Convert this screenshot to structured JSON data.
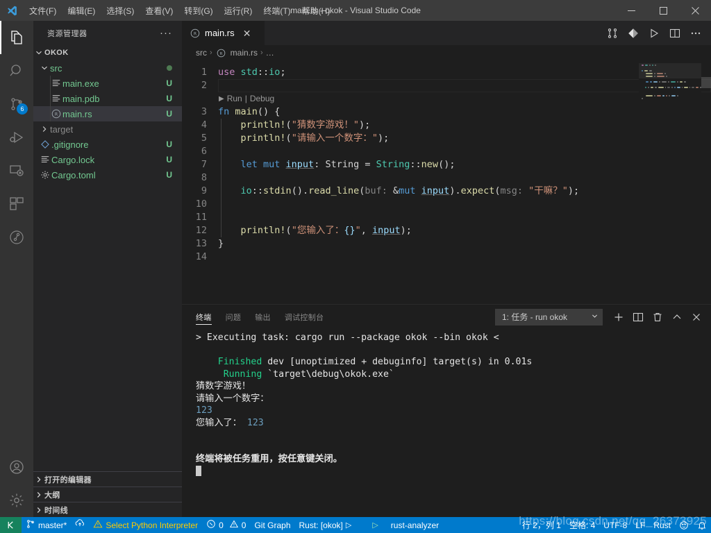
{
  "window": {
    "title": "main.rs - okok - Visual Studio Code",
    "minimize": "─",
    "maximize": "□",
    "close": "✕"
  },
  "menubar": {
    "items": [
      {
        "label": "文件(F)",
        "name": "menu-file"
      },
      {
        "label": "编辑(E)",
        "name": "menu-edit"
      },
      {
        "label": "选择(S)",
        "name": "menu-selection"
      },
      {
        "label": "查看(V)",
        "name": "menu-view"
      },
      {
        "label": "转到(G)",
        "name": "menu-go"
      },
      {
        "label": "运行(R)",
        "name": "menu-run"
      },
      {
        "label": "终端(T)",
        "name": "menu-terminal"
      },
      {
        "label": "帮助(H)",
        "name": "menu-help"
      }
    ]
  },
  "activitybar": {
    "items": [
      {
        "name": "explorer-icon",
        "active": true,
        "badge": ""
      },
      {
        "name": "search-icon",
        "active": false,
        "badge": ""
      },
      {
        "name": "source-control-icon",
        "active": false,
        "badge": "6"
      },
      {
        "name": "run-debug-icon",
        "active": false,
        "badge": ""
      },
      {
        "name": "remote-explorer-icon",
        "active": false,
        "badge": ""
      },
      {
        "name": "extensions-icon",
        "active": false,
        "badge": ""
      },
      {
        "name": "testing-icon",
        "active": false,
        "badge": ""
      }
    ],
    "bottom": [
      {
        "name": "account-icon"
      },
      {
        "name": "settings-gear-icon"
      }
    ],
    "badge_color": "#007acc"
  },
  "sidebar": {
    "title": "资源管理器",
    "more_actions": "···",
    "root": {
      "label": "OKOK",
      "expanded": true
    },
    "tree": [
      {
        "label": "src",
        "indent": 1,
        "kind": "folder",
        "expanded": true,
        "badge": "",
        "dot": true,
        "selected": false,
        "icon": "folder-icon"
      },
      {
        "label": "main.exe",
        "indent": 2,
        "kind": "file",
        "expanded": null,
        "badge": "U",
        "dot": false,
        "selected": false,
        "icon": "binary-file-icon"
      },
      {
        "label": "main.pdb",
        "indent": 2,
        "kind": "file",
        "expanded": null,
        "badge": "U",
        "dot": false,
        "selected": false,
        "icon": "binary-file-icon"
      },
      {
        "label": "main.rs",
        "indent": 2,
        "kind": "file",
        "expanded": null,
        "badge": "U",
        "dot": false,
        "selected": true,
        "icon": "rust-file-icon"
      },
      {
        "label": "target",
        "indent": 1,
        "kind": "folder",
        "expanded": false,
        "badge": "",
        "dot": false,
        "selected": false,
        "icon": "folder-icon"
      },
      {
        "label": ".gitignore",
        "indent": 1,
        "kind": "file",
        "expanded": null,
        "badge": "U",
        "dot": false,
        "selected": false,
        "icon": "git-file-icon"
      },
      {
        "label": "Cargo.lock",
        "indent": 1,
        "kind": "file",
        "expanded": null,
        "badge": "U",
        "dot": false,
        "selected": false,
        "icon": "lock-file-icon"
      },
      {
        "label": "Cargo.toml",
        "indent": 1,
        "kind": "file",
        "expanded": null,
        "badge": "U",
        "dot": false,
        "selected": false,
        "icon": "toml-file-icon"
      }
    ],
    "sections": [
      {
        "label": "打开的编辑器",
        "name": "section-open-editors"
      },
      {
        "label": "大纲",
        "name": "section-outline"
      },
      {
        "label": "时间线",
        "name": "section-timeline"
      }
    ]
  },
  "editor": {
    "tab": {
      "label": "main.rs",
      "close": "✕",
      "icon": "rust-file-icon"
    },
    "actions": [
      {
        "name": "compare-changes-icon"
      },
      {
        "name": "git-diff-icon"
      },
      {
        "name": "run-code-icon"
      },
      {
        "name": "split-editor-icon"
      },
      {
        "name": "more-actions-icon"
      }
    ],
    "breadcrumb": [
      {
        "label": "src",
        "icon": ""
      },
      {
        "label": "main.rs",
        "icon": "rust-file-icon"
      },
      {
        "label": "…",
        "icon": ""
      }
    ],
    "breadcrumb_sep": "›",
    "codelens": {
      "run": "Run",
      "sep": "|",
      "debug": "Debug",
      "play": "▶"
    },
    "line_numbers": [
      "1",
      "2",
      "3",
      "4",
      "5",
      "6",
      "7",
      "8",
      "9",
      "10",
      "11",
      "12",
      "13",
      "14"
    ],
    "code_lines": [
      {
        "n": 1,
        "tokens": [
          {
            "t": "use ",
            "c": "kwc"
          },
          {
            "t": "std",
            "c": "mod"
          },
          {
            "t": "::",
            "c": "pun"
          },
          {
            "t": "io",
            "c": "type"
          },
          {
            "t": ";",
            "c": "pun"
          }
        ]
      },
      {
        "n": 2,
        "tokens": []
      },
      {
        "n": 3,
        "tokens": [
          {
            "t": "fn ",
            "c": "kw"
          },
          {
            "t": "main",
            "c": "fn"
          },
          {
            "t": "() {",
            "c": "pun"
          }
        ]
      },
      {
        "n": 4,
        "tokens": [
          {
            "t": "    ",
            "c": "pun"
          },
          {
            "t": "println!",
            "c": "mac"
          },
          {
            "t": "(",
            "c": "pun"
          },
          {
            "t": "\"猜数字游戏！\"",
            "c": "str"
          },
          {
            "t": ");",
            "c": "pun"
          }
        ]
      },
      {
        "n": 5,
        "tokens": [
          {
            "t": "    ",
            "c": "pun"
          },
          {
            "t": "println!",
            "c": "mac"
          },
          {
            "t": "(",
            "c": "pun"
          },
          {
            "t": "\"请输入一个数字：\"",
            "c": "str"
          },
          {
            "t": ");",
            "c": "pun"
          }
        ]
      },
      {
        "n": 6,
        "tokens": []
      },
      {
        "n": 7,
        "tokens": [
          {
            "t": "    ",
            "c": "pun"
          },
          {
            "t": "let ",
            "c": "kw"
          },
          {
            "t": "mut ",
            "c": "kw"
          },
          {
            "t": "input",
            "c": "var uline"
          },
          {
            "t": ": ",
            "c": "pun"
          },
          {
            "t": "String",
            "c": "pun"
          },
          {
            "t": " = ",
            "c": "pun"
          },
          {
            "t": "String",
            "c": "type"
          },
          {
            "t": "::",
            "c": "pun"
          },
          {
            "t": "new",
            "c": "fn"
          },
          {
            "t": "();",
            "c": "pun"
          }
        ]
      },
      {
        "n": 8,
        "tokens": []
      },
      {
        "n": 9,
        "tokens": [
          {
            "t": "    ",
            "c": "pun"
          },
          {
            "t": "io",
            "c": "type"
          },
          {
            "t": "::",
            "c": "pun"
          },
          {
            "t": "stdin",
            "c": "fn"
          },
          {
            "t": "().",
            "c": "pun"
          },
          {
            "t": "read_line",
            "c": "fn"
          },
          {
            "t": "(",
            "c": "pun"
          },
          {
            "t": "buf: ",
            "c": "hint"
          },
          {
            "t": "&",
            "c": "pun"
          },
          {
            "t": "mut ",
            "c": "kw"
          },
          {
            "t": "input",
            "c": "var uline"
          },
          {
            "t": ").",
            "c": "pun"
          },
          {
            "t": "expect",
            "c": "fn"
          },
          {
            "t": "(",
            "c": "pun"
          },
          {
            "t": "msg: ",
            "c": "hint"
          },
          {
            "t": "\"干嘛？\"",
            "c": "str"
          },
          {
            "t": ");",
            "c": "pun"
          }
        ]
      },
      {
        "n": 10,
        "tokens": []
      },
      {
        "n": 11,
        "tokens": []
      },
      {
        "n": 12,
        "tokens": [
          {
            "t": "    ",
            "c": "pun"
          },
          {
            "t": "println!",
            "c": "mac"
          },
          {
            "t": "(",
            "c": "pun"
          },
          {
            "t": "\"您输入了：",
            "c": "str"
          },
          {
            "t": "{}",
            "c": "var"
          },
          {
            "t": "\"",
            "c": "str"
          },
          {
            "t": ", ",
            "c": "pun"
          },
          {
            "t": "input",
            "c": "var uline"
          },
          {
            "t": ");",
            "c": "pun"
          }
        ]
      },
      {
        "n": 13,
        "tokens": [
          {
            "t": "}",
            "c": "pun"
          }
        ]
      },
      {
        "n": 14,
        "tokens": []
      }
    ]
  },
  "panel": {
    "tabs": [
      {
        "label": "终端",
        "active": true,
        "name": "panel-tab-terminal"
      },
      {
        "label": "问题",
        "active": false,
        "name": "panel-tab-problems"
      },
      {
        "label": "输出",
        "active": false,
        "name": "panel-tab-output"
      },
      {
        "label": "调试控制台",
        "active": false,
        "name": "panel-tab-debug-console"
      }
    ],
    "terminal_select": {
      "value": "1: 任务 - run okok",
      "chevron": "⌄"
    },
    "actions": [
      {
        "name": "new-terminal-icon",
        "glyph": "+"
      },
      {
        "name": "split-terminal-icon",
        "glyph": ""
      },
      {
        "name": "kill-terminal-icon",
        "glyph": ""
      },
      {
        "name": "maximize-panel-icon",
        "glyph": "^"
      },
      {
        "name": "close-panel-icon",
        "glyph": "✕"
      }
    ],
    "terminal_lines": [
      {
        "parts": [
          {
            "t": "> Executing task: cargo run --package okok --bin okok <",
            "c": "t-white"
          }
        ]
      },
      {
        "parts": []
      },
      {
        "parts": [
          {
            "t": "    ",
            "c": ""
          },
          {
            "t": "Finished",
            "c": "t-green"
          },
          {
            "t": " dev [unoptimized + debuginfo] target(s) in 0.01s",
            "c": "t-white"
          }
        ]
      },
      {
        "parts": [
          {
            "t": "     ",
            "c": ""
          },
          {
            "t": "Running",
            "c": "t-green"
          },
          {
            "t": " `target\\debug\\okok.exe`",
            "c": "t-white"
          }
        ]
      },
      {
        "parts": [
          {
            "t": "猜数字游戏！",
            "c": "t-white"
          }
        ]
      },
      {
        "parts": [
          {
            "t": "请输入一个数字：",
            "c": "t-white"
          }
        ]
      },
      {
        "parts": [
          {
            "t": "123",
            "c": "t-cyan"
          }
        ]
      },
      {
        "parts": [
          {
            "t": "您输入了： ",
            "c": "t-white"
          },
          {
            "t": "123",
            "c": "t-cyan"
          }
        ]
      },
      {
        "parts": []
      },
      {
        "parts": []
      },
      {
        "parts": [
          {
            "t": "终端将被任务重用，按任意键关闭。",
            "c": "t-bold"
          }
        ]
      }
    ]
  },
  "statusbar": {
    "remote_icon": "remote-window-icon",
    "left": [
      {
        "label": "master*",
        "icon": "source-control-branch-icon",
        "name": "status-branch"
      },
      {
        "label": "",
        "icon": "sync-changes-icon",
        "name": "status-sync"
      },
      {
        "label": "Select Python Interpreter",
        "icon": "warning-triangle-icon",
        "name": "status-python-interpreter",
        "warn": true
      },
      {
        "label": "0",
        "icon": "error-icon",
        "label2": "0",
        "icon2": "warning-icon",
        "name": "status-problems"
      },
      {
        "label": "Git Graph",
        "icon": "",
        "name": "status-git-graph"
      },
      {
        "label": "Rust: [okok]",
        "icon": "",
        "name": "status-rust-target",
        "trailing": "▷"
      },
      {
        "label": "rust-analyzer",
        "icon": "",
        "name": "status-rust-analyzer",
        "leading": "▷"
      }
    ],
    "right": [
      {
        "label": "行 2，列 1",
        "name": "status-line-col"
      },
      {
        "label": "空格: 4",
        "name": "status-indentation"
      },
      {
        "label": "UTF-8",
        "name": "status-encoding"
      },
      {
        "label": "LF",
        "name": "status-eol"
      },
      {
        "label": "Rust",
        "name": "status-language-mode"
      },
      {
        "label": "",
        "icon": "feedback-smiley-icon",
        "name": "status-feedback"
      },
      {
        "label": "",
        "icon": "bell-icon",
        "name": "status-notifications"
      }
    ],
    "background": "#007acc",
    "remote_background": "#16825d"
  },
  "watermark": {
    "text": "https://blog.csdn.net/qq_26373925"
  }
}
